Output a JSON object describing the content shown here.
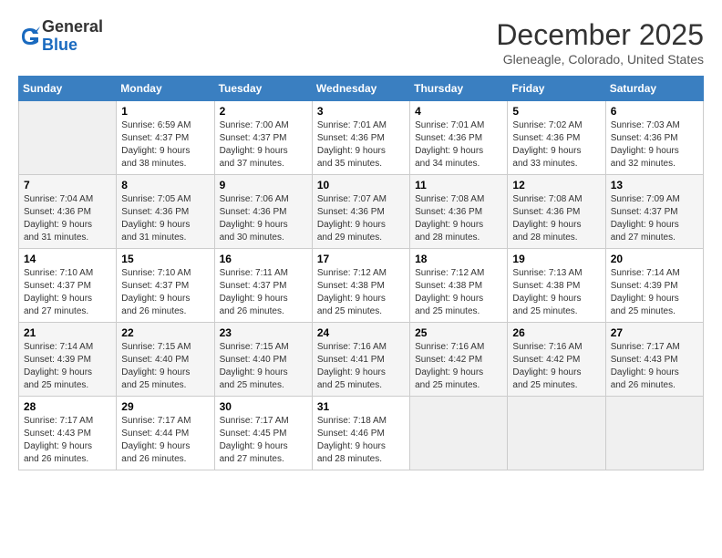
{
  "header": {
    "logo_line1": "General",
    "logo_line2": "Blue",
    "month": "December 2025",
    "location": "Gleneagle, Colorado, United States"
  },
  "days_of_week": [
    "Sunday",
    "Monday",
    "Tuesday",
    "Wednesday",
    "Thursday",
    "Friday",
    "Saturday"
  ],
  "weeks": [
    [
      {
        "num": "",
        "info": ""
      },
      {
        "num": "1",
        "info": "Sunrise: 6:59 AM\nSunset: 4:37 PM\nDaylight: 9 hours\nand 38 minutes."
      },
      {
        "num": "2",
        "info": "Sunrise: 7:00 AM\nSunset: 4:37 PM\nDaylight: 9 hours\nand 37 minutes."
      },
      {
        "num": "3",
        "info": "Sunrise: 7:01 AM\nSunset: 4:36 PM\nDaylight: 9 hours\nand 35 minutes."
      },
      {
        "num": "4",
        "info": "Sunrise: 7:01 AM\nSunset: 4:36 PM\nDaylight: 9 hours\nand 34 minutes."
      },
      {
        "num": "5",
        "info": "Sunrise: 7:02 AM\nSunset: 4:36 PM\nDaylight: 9 hours\nand 33 minutes."
      },
      {
        "num": "6",
        "info": "Sunrise: 7:03 AM\nSunset: 4:36 PM\nDaylight: 9 hours\nand 32 minutes."
      }
    ],
    [
      {
        "num": "7",
        "info": "Sunrise: 7:04 AM\nSunset: 4:36 PM\nDaylight: 9 hours\nand 31 minutes."
      },
      {
        "num": "8",
        "info": "Sunrise: 7:05 AM\nSunset: 4:36 PM\nDaylight: 9 hours\nand 31 minutes."
      },
      {
        "num": "9",
        "info": "Sunrise: 7:06 AM\nSunset: 4:36 PM\nDaylight: 9 hours\nand 30 minutes."
      },
      {
        "num": "10",
        "info": "Sunrise: 7:07 AM\nSunset: 4:36 PM\nDaylight: 9 hours\nand 29 minutes."
      },
      {
        "num": "11",
        "info": "Sunrise: 7:08 AM\nSunset: 4:36 PM\nDaylight: 9 hours\nand 28 minutes."
      },
      {
        "num": "12",
        "info": "Sunrise: 7:08 AM\nSunset: 4:36 PM\nDaylight: 9 hours\nand 28 minutes."
      },
      {
        "num": "13",
        "info": "Sunrise: 7:09 AM\nSunset: 4:37 PM\nDaylight: 9 hours\nand 27 minutes."
      }
    ],
    [
      {
        "num": "14",
        "info": "Sunrise: 7:10 AM\nSunset: 4:37 PM\nDaylight: 9 hours\nand 27 minutes."
      },
      {
        "num": "15",
        "info": "Sunrise: 7:10 AM\nSunset: 4:37 PM\nDaylight: 9 hours\nand 26 minutes."
      },
      {
        "num": "16",
        "info": "Sunrise: 7:11 AM\nSunset: 4:37 PM\nDaylight: 9 hours\nand 26 minutes."
      },
      {
        "num": "17",
        "info": "Sunrise: 7:12 AM\nSunset: 4:38 PM\nDaylight: 9 hours\nand 25 minutes."
      },
      {
        "num": "18",
        "info": "Sunrise: 7:12 AM\nSunset: 4:38 PM\nDaylight: 9 hours\nand 25 minutes."
      },
      {
        "num": "19",
        "info": "Sunrise: 7:13 AM\nSunset: 4:38 PM\nDaylight: 9 hours\nand 25 minutes."
      },
      {
        "num": "20",
        "info": "Sunrise: 7:14 AM\nSunset: 4:39 PM\nDaylight: 9 hours\nand 25 minutes."
      }
    ],
    [
      {
        "num": "21",
        "info": "Sunrise: 7:14 AM\nSunset: 4:39 PM\nDaylight: 9 hours\nand 25 minutes."
      },
      {
        "num": "22",
        "info": "Sunrise: 7:15 AM\nSunset: 4:40 PM\nDaylight: 9 hours\nand 25 minutes."
      },
      {
        "num": "23",
        "info": "Sunrise: 7:15 AM\nSunset: 4:40 PM\nDaylight: 9 hours\nand 25 minutes."
      },
      {
        "num": "24",
        "info": "Sunrise: 7:16 AM\nSunset: 4:41 PM\nDaylight: 9 hours\nand 25 minutes."
      },
      {
        "num": "25",
        "info": "Sunrise: 7:16 AM\nSunset: 4:42 PM\nDaylight: 9 hours\nand 25 minutes."
      },
      {
        "num": "26",
        "info": "Sunrise: 7:16 AM\nSunset: 4:42 PM\nDaylight: 9 hours\nand 25 minutes."
      },
      {
        "num": "27",
        "info": "Sunrise: 7:17 AM\nSunset: 4:43 PM\nDaylight: 9 hours\nand 26 minutes."
      }
    ],
    [
      {
        "num": "28",
        "info": "Sunrise: 7:17 AM\nSunset: 4:43 PM\nDaylight: 9 hours\nand 26 minutes."
      },
      {
        "num": "29",
        "info": "Sunrise: 7:17 AM\nSunset: 4:44 PM\nDaylight: 9 hours\nand 26 minutes."
      },
      {
        "num": "30",
        "info": "Sunrise: 7:17 AM\nSunset: 4:45 PM\nDaylight: 9 hours\nand 27 minutes."
      },
      {
        "num": "31",
        "info": "Sunrise: 7:18 AM\nSunset: 4:46 PM\nDaylight: 9 hours\nand 28 minutes."
      },
      {
        "num": "",
        "info": ""
      },
      {
        "num": "",
        "info": ""
      },
      {
        "num": "",
        "info": ""
      }
    ]
  ]
}
